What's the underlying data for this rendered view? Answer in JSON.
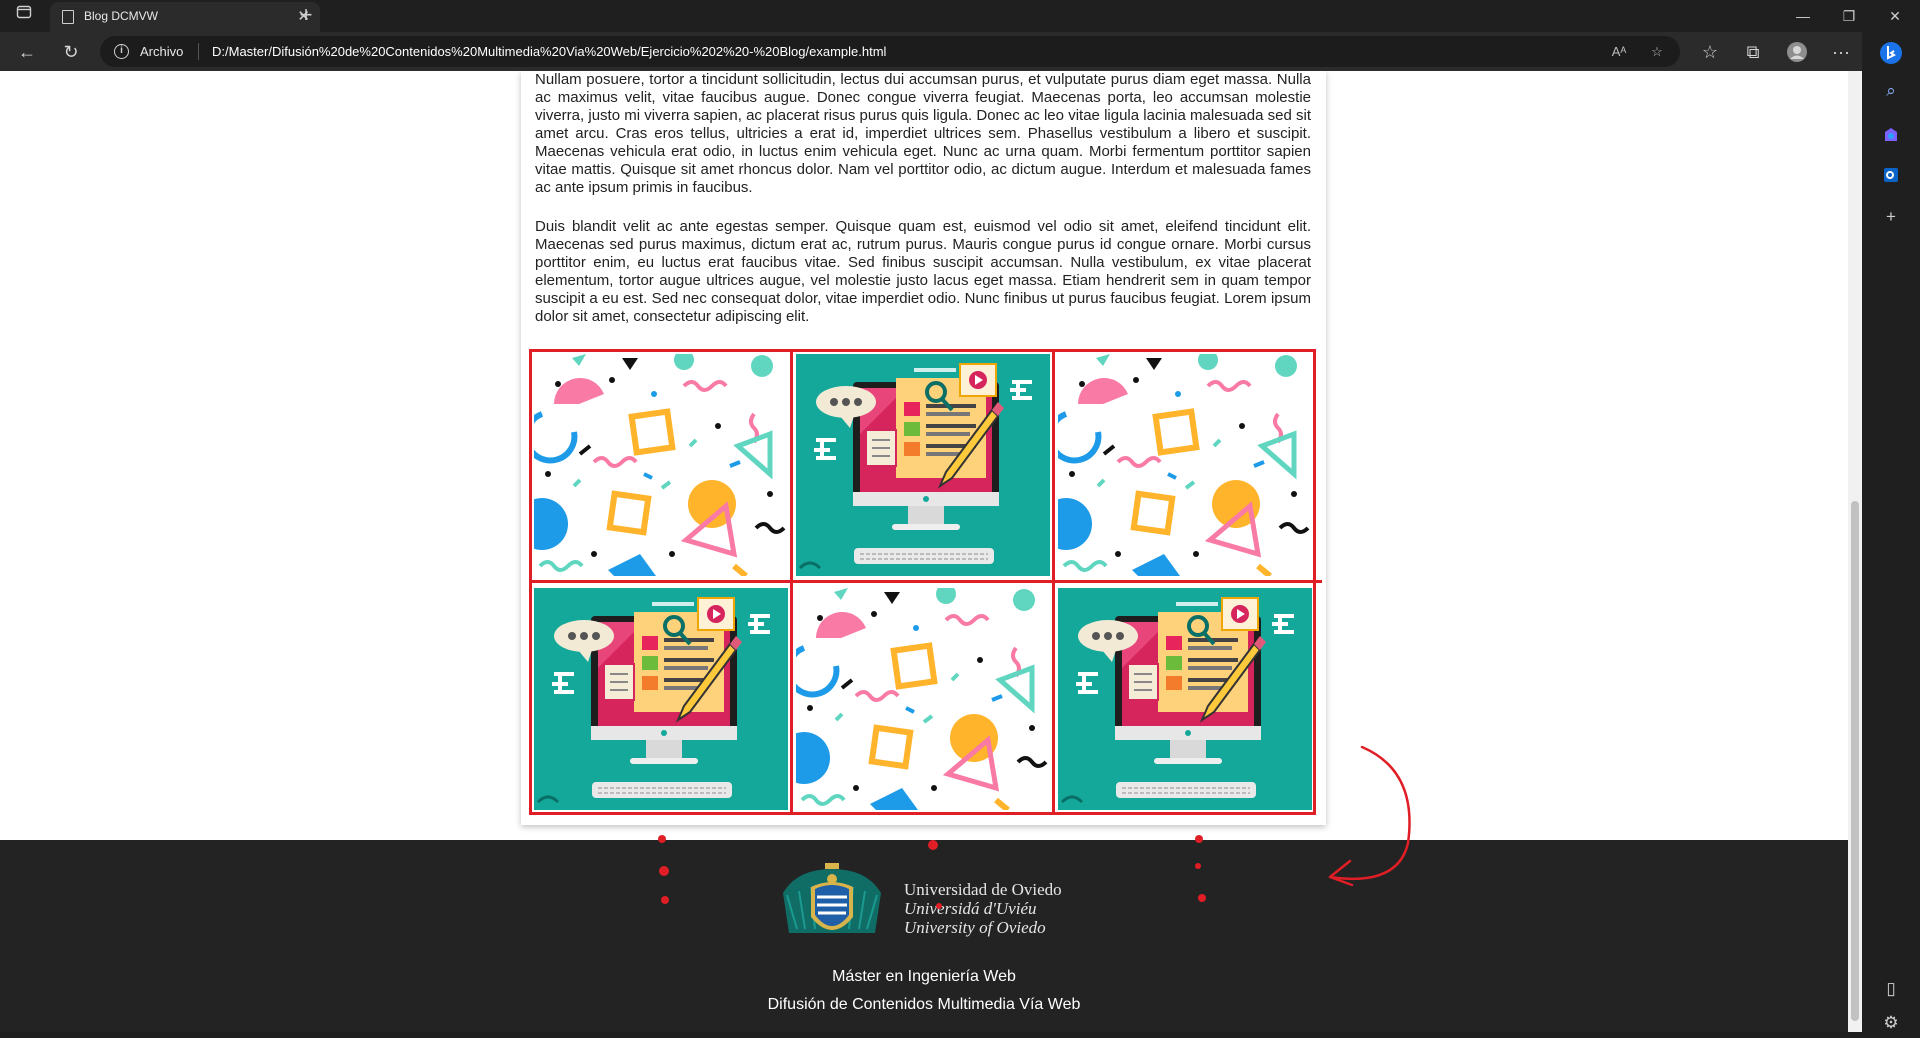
{
  "browser": {
    "tab_title": "Blog DCMVW",
    "site_info_label": "Archivo",
    "url": "D:/Master/Difusión%20de%20Contenidos%20Multimedia%20Via%20Web/Ejercicio%202%20-%20Blog/example.html",
    "icons": {
      "tab_actions": "tab-actions-icon",
      "tab_page": "page-icon",
      "tab_close": "close-icon",
      "new_tab": "plus-icon",
      "minimize": "minimize-icon",
      "restore": "restore-icon",
      "close_window": "close-icon",
      "back": "back-arrow-icon",
      "refresh": "refresh-icon",
      "read_aloud": "read-aloud-icon",
      "favorite_add": "star-plus-icon",
      "favorites": "favorites-icon",
      "collections": "collections-icon",
      "profile": "profile-icon",
      "more": "more-icon"
    }
  },
  "article": {
    "paragraphs": [
      "Nullam posuere, tortor a tincidunt sollicitudin, lectus dui accumsan purus, et vulputate purus diam eget massa. Nulla ac maximus velit, vitae faucibus augue. Donec congue viverra feugiat. Maecenas porta, leo accumsan molestie viverra, justo mi viverra sapien, ac placerat risus purus quis ligula. Donec ac leo vitae ligula lacinia malesuada sed sit amet arcu. Cras eros tellus, ultricies a erat id, imperdiet ultrices sem. Phasellus vestibulum a libero et suscipit. Maecenas vehicula erat odio, in luctus enim vehicula eget. Nunc ac urna quam. Morbi fermentum porttitor sapien vitae mattis. Quisque sit amet rhoncus dolor. Nam vel porttitor odio, ac dictum augue. Interdum et malesuada fames ac ante ipsum primis in faucibus.",
      "Duis blandit velit ac ante egestas semper. Quisque quam est, euismod vel odio sit amet, eleifend tincidunt elit. Maecenas sed purus maximus, dictum erat ac, rutrum purus. Mauris congue purus id congue ornare. Morbi cursus porttitor enim, eu luctus erat faucibus vitae. Sed finibus suscipit accumsan. Nulla vestibulum, ex vitae placerat elementum, tortor augue ultrices augue, vel molestie justo lacus eget massa. Etiam hendrerit sem in quam tempor suscipit a eu est. Sed nec consequat dolor, vitae imperdiet odio. Nunc finibus ut purus faucibus feugiat. Lorem ipsum dolor sit amet, consectetur adipiscing elit."
    ],
    "gallery": [
      {
        "image": "confetti-pattern"
      },
      {
        "image": "computer-illustration"
      },
      {
        "image": "confetti-pattern"
      },
      {
        "image": "computer-illustration"
      },
      {
        "image": "confetti-pattern"
      },
      {
        "image": "computer-illustration"
      }
    ],
    "highlight_color": "#e01e25"
  },
  "footer": {
    "university": [
      "Universidad de Oviedo",
      "Universidá d'Uviéu",
      "University of Oviedo"
    ],
    "line1": "Máster en Ingeniería Web",
    "line2": "Difusión de Contenidos Multimedia Vía Web",
    "background": "#232323"
  },
  "sidebar": {
    "icons": [
      "bing-copilot-icon",
      "search-icon",
      "shopping-icon",
      "outlook-icon",
      "add-icon",
      "split-screen-icon",
      "settings-icon"
    ]
  },
  "colors": {
    "teal": "#14a89a",
    "accent_red": "#e01e25"
  }
}
